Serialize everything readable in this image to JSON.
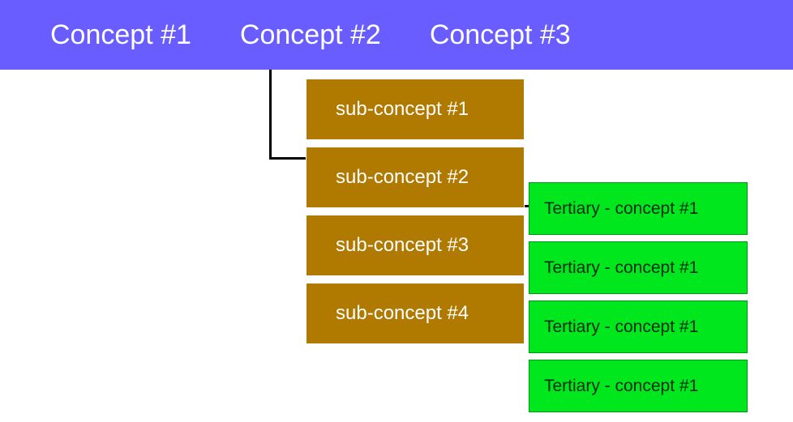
{
  "topbar": {
    "concepts": [
      {
        "label": "Concept #1"
      },
      {
        "label": "Concept #2"
      },
      {
        "label": "Concept #3"
      }
    ]
  },
  "sub": {
    "items": [
      {
        "label": "sub-concept #1"
      },
      {
        "label": "sub-concept #2"
      },
      {
        "label": "sub-concept #3"
      },
      {
        "label": "sub-concept #4"
      }
    ]
  },
  "tertiary": {
    "items": [
      {
        "label": "Tertiary - concept #1"
      },
      {
        "label": "Tertiary - concept #1"
      },
      {
        "label": "Tertiary - concept #1"
      },
      {
        "label": "Tertiary - concept #1"
      }
    ]
  },
  "colors": {
    "topbar_bg": "#6a5dff",
    "sub_bg": "#b07900",
    "tertiary_bg": "#00e81d"
  }
}
